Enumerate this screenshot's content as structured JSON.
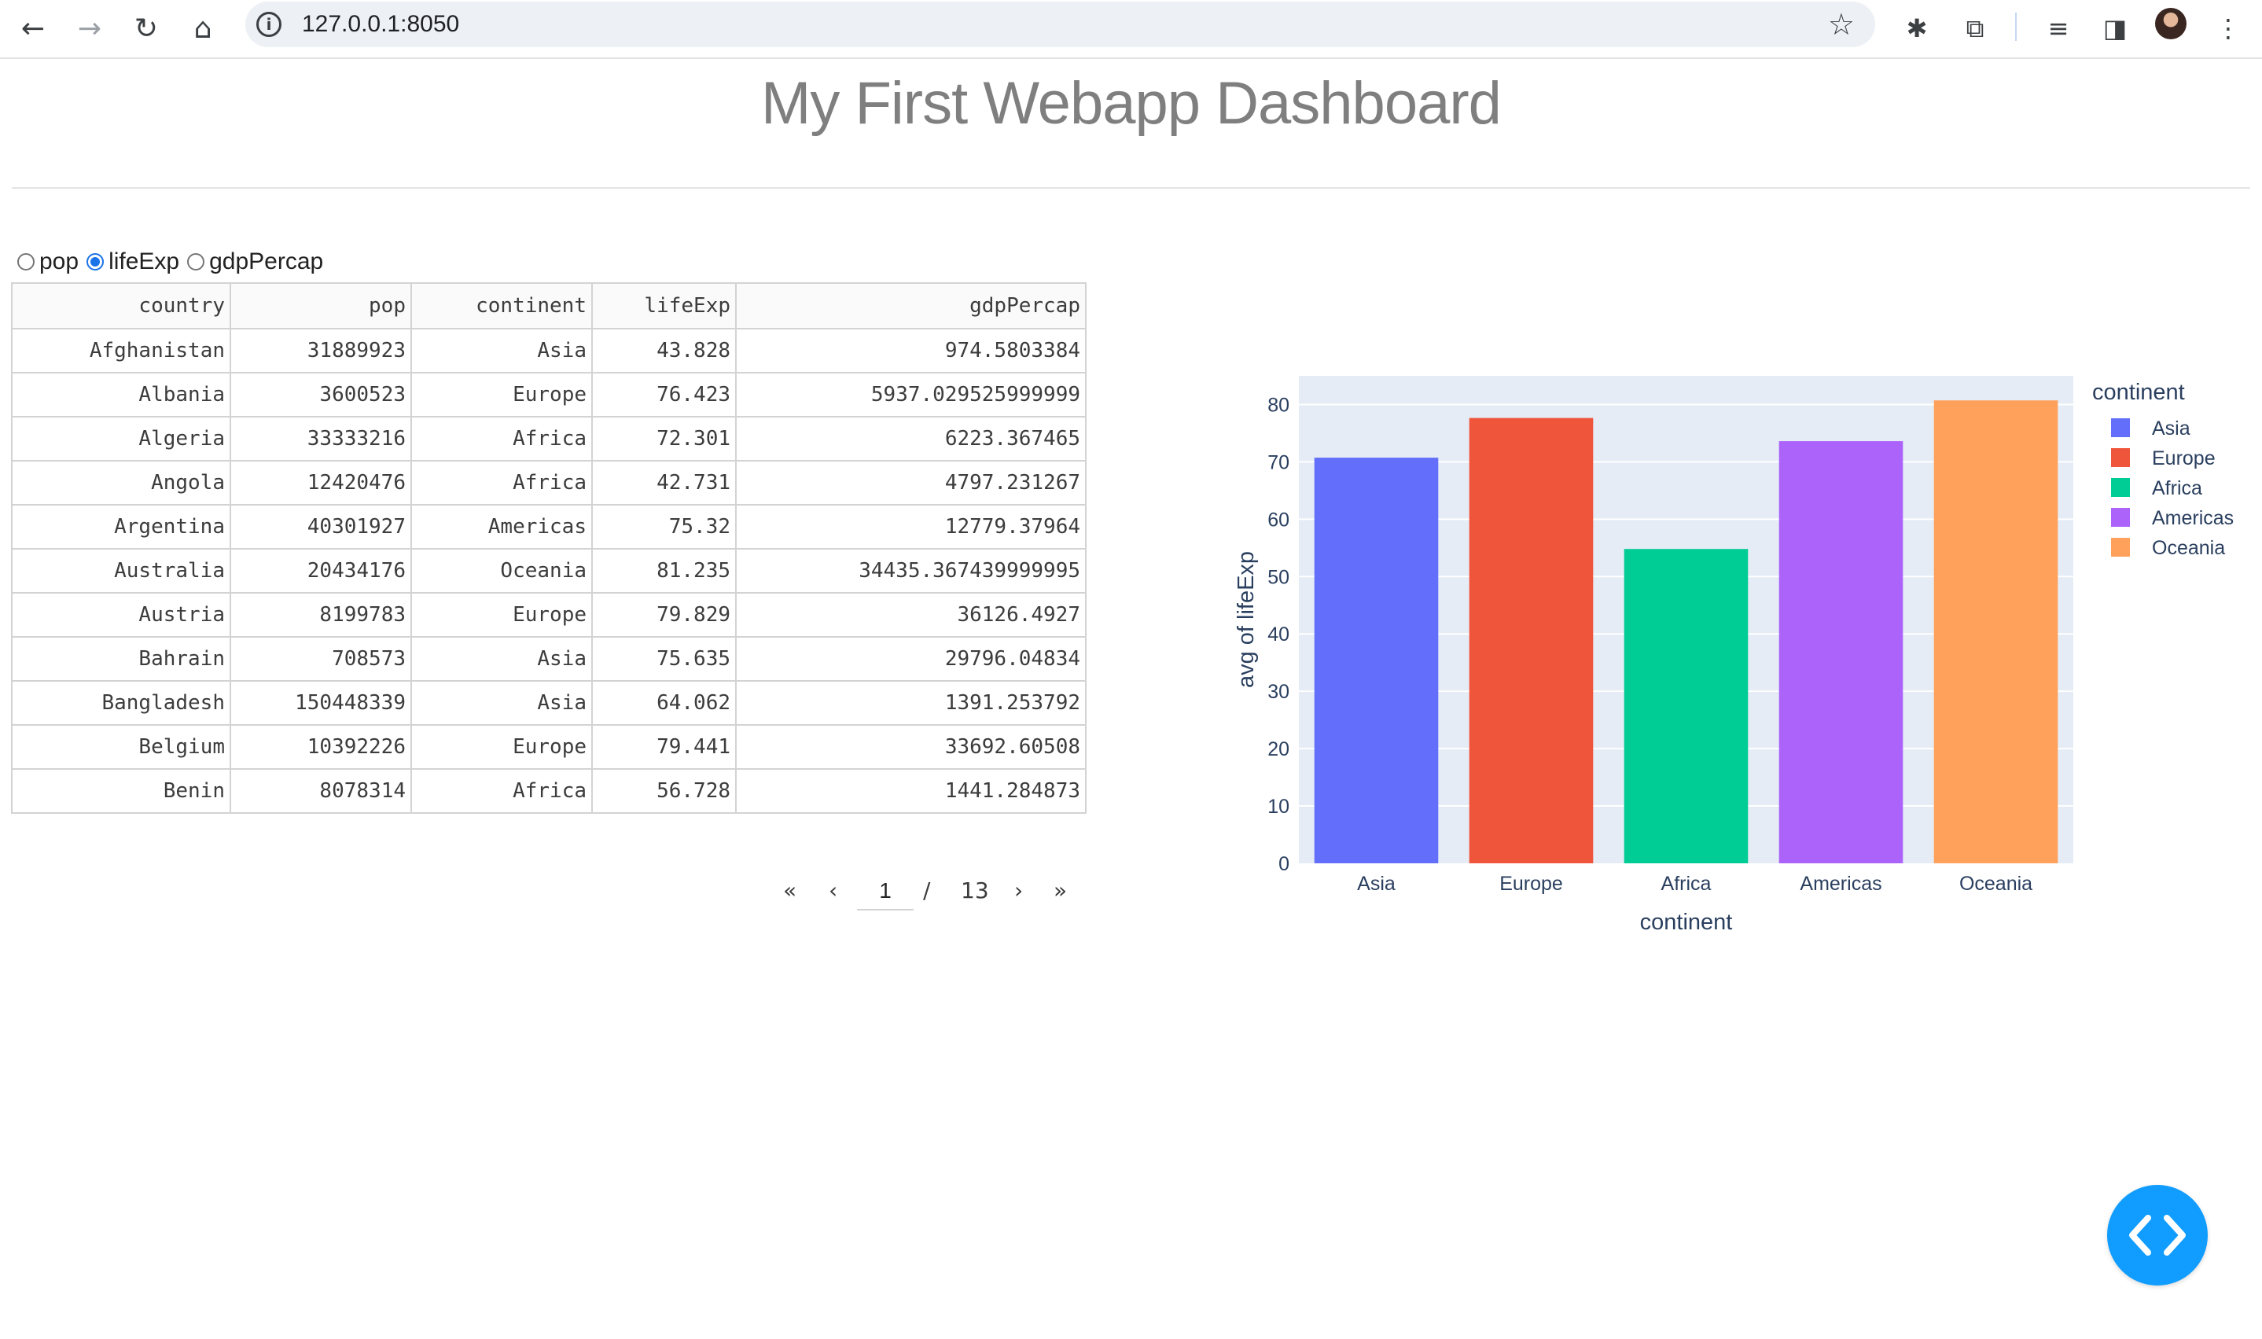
{
  "browser": {
    "url": "127.0.0.1:8050",
    "icons": [
      "back-icon",
      "forward-icon",
      "reload-icon",
      "home-icon",
      "site-info-icon",
      "bookmark-star-icon",
      "extension-bug-icon",
      "extensions-puzzle-icon",
      "media-controls-icon",
      "side-panel-icon",
      "profile-avatar",
      "menu-dots-icon"
    ]
  },
  "page": {
    "title": "My First Webapp Dashboard"
  },
  "radio": {
    "options": [
      "pop",
      "lifeExp",
      "gdpPercap"
    ],
    "selected": "lifeExp"
  },
  "table": {
    "columns": [
      "country",
      "pop",
      "continent",
      "lifeExp",
      "gdpPercap"
    ],
    "rows": [
      [
        "Afghanistan",
        "31889923",
        "Asia",
        "43.828",
        "974.5803384"
      ],
      [
        "Albania",
        "3600523",
        "Europe",
        "76.423",
        "5937.029525999999"
      ],
      [
        "Algeria",
        "33333216",
        "Africa",
        "72.301",
        "6223.367465"
      ],
      [
        "Angola",
        "12420476",
        "Africa",
        "42.731",
        "4797.231267"
      ],
      [
        "Argentina",
        "40301927",
        "Americas",
        "75.32",
        "12779.37964"
      ],
      [
        "Australia",
        "20434176",
        "Oceania",
        "81.235",
        "34435.367439999995"
      ],
      [
        "Austria",
        "8199783",
        "Europe",
        "79.829",
        "36126.4927"
      ],
      [
        "Bahrain",
        "708573",
        "Asia",
        "75.635",
        "29796.04834"
      ],
      [
        "Bangladesh",
        "150448339",
        "Asia",
        "64.062",
        "1391.253792"
      ],
      [
        "Belgium",
        "10392226",
        "Europe",
        "79.441",
        "33692.60508"
      ],
      [
        "Benin",
        "8078314",
        "Africa",
        "56.728",
        "1441.284873"
      ]
    ]
  },
  "pagination": {
    "first": "«",
    "prev": "‹",
    "current": "1",
    "separator": "/",
    "total": "13",
    "next": "›",
    "last": "»"
  },
  "chart_data": {
    "type": "bar",
    "categories": [
      "Asia",
      "Europe",
      "Africa",
      "Americas",
      "Oceania"
    ],
    "values": [
      70.73,
      77.65,
      54.81,
      73.61,
      80.72
    ],
    "colors": [
      "#636efa",
      "#ef553b",
      "#00cc96",
      "#ab63fa",
      "#ffa15a"
    ],
    "xlabel": "continent",
    "ylabel": "avg of lifeExp",
    "ylim": [
      0,
      85
    ],
    "yticks": [
      0,
      10,
      20,
      30,
      40,
      50,
      60,
      70,
      80
    ],
    "legend_title": "continent",
    "legend_placement": "top-right",
    "plot_background": "#e5ecf6",
    "grid": true
  },
  "fab": {
    "icon": "code-brackets-icon"
  }
}
